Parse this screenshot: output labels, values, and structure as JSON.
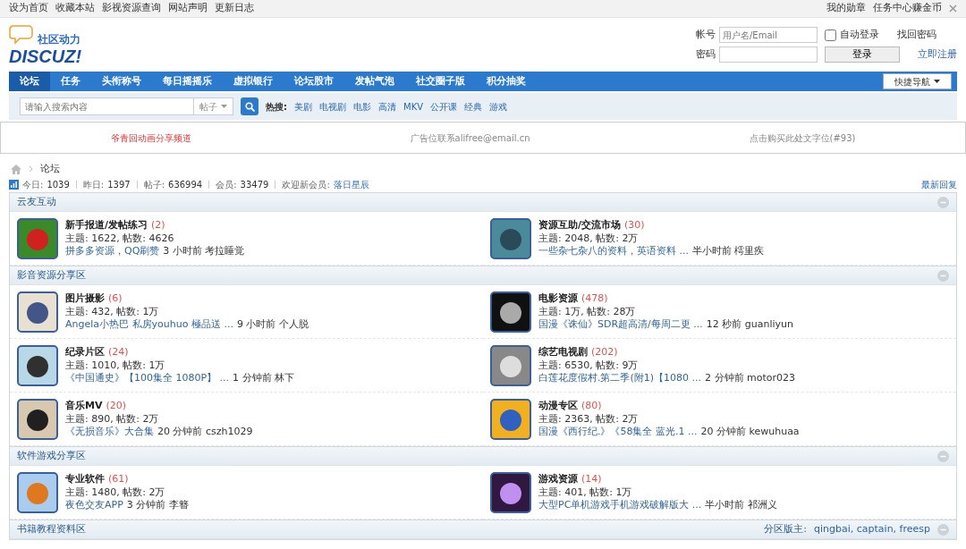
{
  "topbar": {
    "left_links": [
      "设为首页",
      "收藏本站",
      "影视资源查询",
      "网站声明",
      "更新日志"
    ],
    "right_links": [
      "我的勋章",
      "任务中心赚金币"
    ]
  },
  "logo": {
    "tagline": "社区动力",
    "wordmark": "DISCUZ!"
  },
  "login": {
    "account_label": "帐号",
    "account_placeholder": "用户名/Email",
    "auto_login": {
      "label": "自动登录",
      "checked": false
    },
    "forgot": "找回密码",
    "password_label": "密码",
    "login_button": "登录",
    "register": "立即注册"
  },
  "nav": {
    "items": [
      {
        "label": "论坛",
        "selected": true
      },
      {
        "label": "任务",
        "selected": false
      },
      {
        "label": "头衔称号",
        "selected": false
      },
      {
        "label": "每日摇摇乐",
        "selected": false
      },
      {
        "label": "虚拟银行",
        "selected": false
      },
      {
        "label": "论坛股市",
        "selected": false
      },
      {
        "label": "发帖气泡",
        "selected": false
      },
      {
        "label": "社交圈子版",
        "selected": false
      },
      {
        "label": "积分抽奖",
        "selected": false
      }
    ],
    "quick_nav": "快捷导航"
  },
  "search": {
    "placeholder": "请输入搜索内容",
    "scope": "帖子",
    "hot_label": "热搜:",
    "hot": [
      "美剧",
      "电视剧",
      "电影",
      "高清",
      "MKV",
      "公开课",
      "经典",
      "游戏"
    ]
  },
  "ads": [
    {
      "text": "爷青回动画分享频道",
      "kind": "highlight"
    },
    {
      "text": "广告位联系alifree@email.cn",
      "kind": "plain"
    },
    {
      "text": "点击购买此处文字位(#93)",
      "kind": "plain"
    }
  ],
  "breadcrumb": {
    "current": "论坛"
  },
  "stats": {
    "items": [
      {
        "label": "今日:",
        "value": "1039"
      },
      {
        "label": "昨日:",
        "value": "1397"
      },
      {
        "label": "帖子:",
        "value": "636994"
      },
      {
        "label": "会员:",
        "value": "33479"
      }
    ],
    "welcome_label": "欢迎新会员:",
    "new_member": "落日星辰",
    "latest": "最新回复"
  },
  "categories": [
    {
      "title": "云友互动",
      "forums": [
        {
          "name": "新手报道/发帖练习",
          "count": "(2)",
          "stats": "主题: 1622, 帖数: 4626",
          "last_title": "拼多多资源，QQ刷赞",
          "last_meta": "3 小时前 考拉睡觉"
        },
        {
          "name": "资源互助/交流市场",
          "count": "(30)",
          "stats": "主题: 2048, 帖数: 2万",
          "last_title": "一些杂七杂八的资料，英语资料 ...",
          "last_meta": "半小时前 樗里疾"
        }
      ]
    },
    {
      "title": "影音资源分享区",
      "forums": [
        {
          "name": "图片摄影",
          "count": "(6)",
          "stats": "主题: 432, 帖数: 1万",
          "last_title": "Angela小热巴 私房youhuo 極品送 ...",
          "last_meta": "9 小时前 个人脱"
        },
        {
          "name": "电影资源",
          "count": "(478)",
          "stats": "主题: 1万, 帖数: 28万",
          "last_title": "国漫《诛仙》SDR超高清/每周二更 ...",
          "last_meta": "12 秒前 guanliyun"
        },
        {
          "name": "纪录片区",
          "count": "(24)",
          "stats": "主题: 1010, 帖数: 1万",
          "last_title": "《中国通史》【100集全 1080P】 ...",
          "last_meta": "1 分钟前 林下"
        },
        {
          "name": "综艺电视剧",
          "count": "(202)",
          "stats": "主题: 6530, 帖数: 9万",
          "last_title": "白莲花度假村.第二季(附1)【1080 ...",
          "last_meta": "2 分钟前 motor023"
        },
        {
          "name": "音乐MV",
          "count": "(20)",
          "stats": "主题: 890, 帖数: 2万",
          "last_title": "《无损音乐》大合集",
          "last_meta": "20 分钟前 cszh1029"
        },
        {
          "name": "动漫专区",
          "count": "(80)",
          "stats": "主题: 2363, 帖数: 2万",
          "last_title": "国漫《西行纪.》《58集全 蓝光.1 ...",
          "last_meta": "20 分钟前 kewuhuaa"
        }
      ]
    },
    {
      "title": "软件游戏分享区",
      "forums": [
        {
          "name": "专业软件",
          "count": "(61)",
          "stats": "主题: 1480, 帖数: 2万",
          "last_title": "夜色交友APP",
          "last_meta": "3 分钟前 李簪"
        },
        {
          "name": "游戏资源",
          "count": "(14)",
          "stats": "主题: 401, 帖数: 1万",
          "last_title": "大型PC单机游戏手机游戏破解版大 ...",
          "last_meta": "半小时前 祁洲义"
        }
      ]
    },
    {
      "title": "书籍教程资料区",
      "moderator_label": "分区版主:",
      "moderators": "qingbai, captain, freesp"
    }
  ]
}
